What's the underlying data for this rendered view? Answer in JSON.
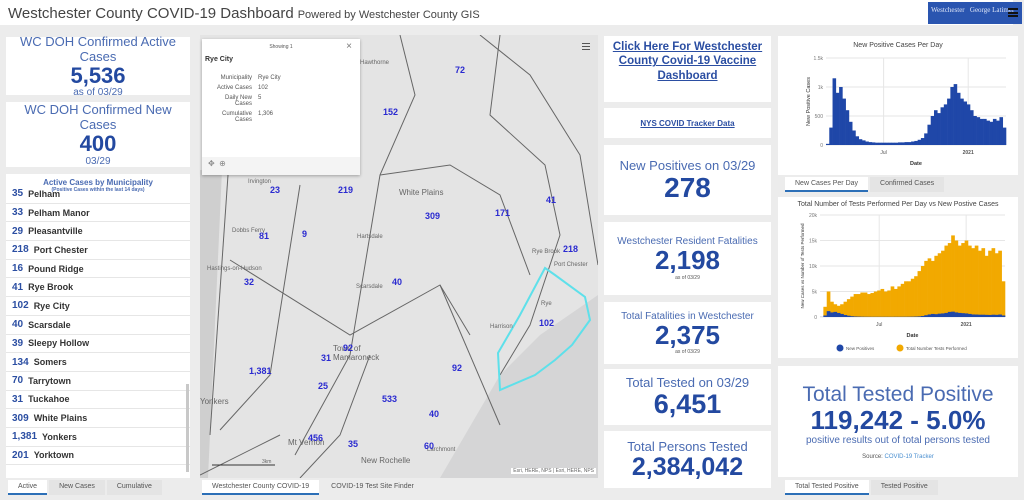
{
  "header": {
    "title": "Westchester County COVID-19 Dashboard",
    "subtitle": "Powered by Westchester County GIS",
    "logo_text": "Westchester gov.com George Latimer"
  },
  "active_cases": {
    "label": "WC DOH Confirmed Active Cases",
    "value": "5,536",
    "date": "as of 03/29"
  },
  "new_cases": {
    "label": "WC DOH Confirmed New Cases",
    "value": "400",
    "date": "03/29"
  },
  "municipality_list": {
    "title": "Active Cases by Municipality",
    "subtitle": "(Positive Cases within the last 14 days)",
    "rows": [
      {
        "n": "35",
        "name": "Pelham"
      },
      {
        "n": "33",
        "name": "Pelham Manor"
      },
      {
        "n": "29",
        "name": "Pleasantville"
      },
      {
        "n": "218",
        "name": "Port Chester"
      },
      {
        "n": "16",
        "name": "Pound Ridge"
      },
      {
        "n": "41",
        "name": "Rye Brook"
      },
      {
        "n": "102",
        "name": "Rye City"
      },
      {
        "n": "40",
        "name": "Scarsdale"
      },
      {
        "n": "39",
        "name": "Sleepy Hollow"
      },
      {
        "n": "134",
        "name": "Somers"
      },
      {
        "n": "70",
        "name": "Tarrytown"
      },
      {
        "n": "31",
        "name": "Tuckahoe"
      },
      {
        "n": "309",
        "name": "White Plains"
      },
      {
        "n": "1,381",
        "name": "Yonkers"
      },
      {
        "n": "201",
        "name": "Yorktown"
      }
    ],
    "tabs": [
      "Active",
      "New Cases",
      "Cumulative"
    ]
  },
  "popup": {
    "showing": "Showing 1",
    "title": "Rye City",
    "fields": [
      {
        "k": "Municipality",
        "v": "Rye City"
      },
      {
        "k": "Active Cases",
        "v": "102"
      },
      {
        "k": "Daily New Cases",
        "v": "5"
      },
      {
        "k": "Cumulative Cases",
        "v": "1,306"
      }
    ]
  },
  "map": {
    "numbers": [
      "72",
      "152",
      "23",
      "219",
      "81",
      "9",
      "32",
      "309",
      "171",
      "41",
      "218",
      "40",
      "102",
      "92",
      "31",
      "25",
      "1,381",
      "533",
      "92",
      "456",
      "35",
      "40",
      "60"
    ],
    "places": [
      "Hawthorne",
      "Irvington",
      "White Plains",
      "Dobbs Ferry",
      "Hartsdale",
      "Hastings-on-Hudson",
      "Scarsdale",
      "Rye Brook",
      "Port Chester",
      "Rye",
      "Harrison",
      "Town of Mamaroneck",
      "Yonkers",
      "New Rochelle",
      "Mt Vernon",
      "Larchmont"
    ],
    "attribution": "Esri, HERE, NPS | Esri, HERE, NPS",
    "scale": "3km",
    "highlight_color": "#5ee0ea",
    "tabs": [
      "Westchester County COVID-19",
      "COVID-19 Test Site Finder"
    ]
  },
  "links": {
    "vaccine": "Click Here For Westchester County Covid-19 Vaccine Dashboard",
    "nys": "NYS COVID Tracker Data"
  },
  "new_positives": {
    "label": "New Positives on 03/29",
    "value": "278"
  },
  "resident_fatalities": {
    "label": "Westchester Resident Fatalities",
    "value": "2,198",
    "date": "as of 03/29"
  },
  "total_fatalities": {
    "label": "Total Fatalities in Westchester",
    "value": "2,375",
    "date": "as of 03/29"
  },
  "tested_today": {
    "label": "Total Tested on 03/29",
    "value": "6,451"
  },
  "persons_tested": {
    "label": "Total Persons Tested",
    "value": "2,384,042"
  },
  "tested_positive": {
    "label": "Total Tested Positive",
    "value": "119,242 - 5.0%",
    "desc": "positive results out of total persons tested",
    "source_label": "Source:",
    "source_link": "COVID-19 Tracker",
    "tabs": [
      "Total Tested Positive",
      "Tested Positive"
    ]
  },
  "chart_tabs": [
    "New Cases Per Day",
    "Confirmed Cases"
  ],
  "chart_data": [
    {
      "type": "bar",
      "title": "New Positive Cases Per Day",
      "xlabel": "Date",
      "ylabel": "New Positive Cases",
      "x_ticks": [
        "Jul",
        "2021"
      ],
      "y_ticks": [
        "0",
        "500",
        "1k",
        "1.5k"
      ],
      "ylim": [
        0,
        1500
      ],
      "color": "#1f47a8",
      "x_range": [
        "2020-03",
        "2021-03"
      ],
      "values": [
        20,
        300,
        1150,
        900,
        1000,
        800,
        600,
        400,
        250,
        150,
        100,
        80,
        60,
        50,
        45,
        40,
        40,
        40,
        40,
        40,
        40,
        40,
        45,
        45,
        50,
        50,
        60,
        70,
        90,
        120,
        200,
        350,
        500,
        600,
        550,
        650,
        700,
        800,
        1000,
        1050,
        900,
        800,
        750,
        700,
        600,
        500,
        480,
        450,
        450,
        420,
        400,
        450,
        420,
        480,
        300
      ]
    },
    {
      "type": "area",
      "title": "Total Number of Tests Performed Per Day vs New Postive Cases",
      "xlabel": "Date",
      "ylabel": "New Cases vs Number of Tests Performed",
      "x_ticks": [
        "Jul",
        "2021"
      ],
      "y_ticks": [
        "0",
        "5k",
        "10k",
        "15k",
        "20k"
      ],
      "ylim": [
        0,
        20000
      ],
      "legend": "bottom",
      "series": [
        {
          "name": "New Positives",
          "color": "#1f47a8",
          "values": [
            20,
            300,
            1150,
            900,
            1000,
            800,
            600,
            400,
            250,
            150,
            100,
            80,
            60,
            50,
            45,
            40,
            40,
            40,
            40,
            40,
            40,
            40,
            45,
            45,
            50,
            50,
            60,
            70,
            90,
            120,
            200,
            350,
            500,
            600,
            550,
            650,
            700,
            800,
            1000,
            1050,
            900,
            800,
            750,
            700,
            600,
            500,
            480,
            450,
            450,
            420,
            400,
            450,
            420,
            480,
            300
          ]
        },
        {
          "name": "Total Number Tests Performed",
          "color": "#f2a900",
          "values": [
            0,
            2000,
            5000,
            3000,
            2500,
            2200,
            2500,
            3000,
            3500,
            4000,
            4500,
            4500,
            4800,
            4800,
            4500,
            4700,
            5000,
            5200,
            5500,
            5000,
            5200,
            6000,
            5500,
            6000,
            6500,
            7000,
            7000,
            7500,
            8000,
            9000,
            10000,
            11000,
            11500,
            11000,
            12000,
            12500,
            13000,
            14000,
            14500,
            16000,
            15000,
            14000,
            14500,
            15000,
            14000,
            13500,
            14000,
            13000,
            13500,
            12000,
            13000,
            13500,
            12500,
            13000,
            7000
          ]
        }
      ]
    }
  ]
}
